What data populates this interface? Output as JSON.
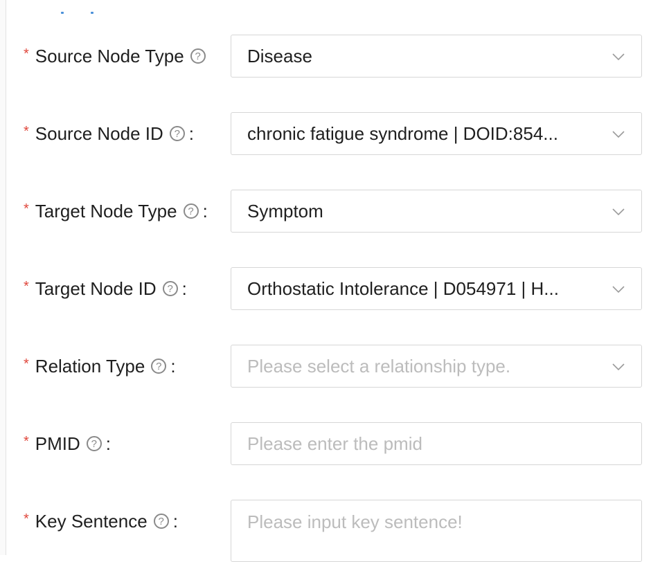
{
  "form": {
    "fields": [
      {
        "label": "Source Node Type",
        "colon": "",
        "value": "Disease",
        "placeholder": "",
        "control": "select"
      },
      {
        "label": "Source Node ID",
        "colon": ":",
        "value": "chronic fatigue syndrome | DOID:854...",
        "placeholder": "",
        "control": "select"
      },
      {
        "label": "Target Node Type",
        "colon": ":",
        "value": "Symptom",
        "placeholder": "",
        "control": "select"
      },
      {
        "label": "Target Node ID",
        "colon": ":",
        "value": "Orthostatic Intolerance | D054971 | H...",
        "placeholder": "",
        "control": "select"
      },
      {
        "label": "Relation Type",
        "colon": ":",
        "value": "",
        "placeholder": "Please select a relationship type.",
        "control": "select"
      },
      {
        "label": "PMID",
        "colon": ":",
        "value": "",
        "placeholder": "Please enter the pmid",
        "control": "input"
      },
      {
        "label": "Key Sentence",
        "colon": ":",
        "value": "",
        "placeholder": "Please input key sentence!",
        "control": "textarea"
      }
    ],
    "required_marker": "*",
    "help_icon": "question-circle-icon",
    "help_glyph": "?",
    "chevron_icon": "chevron-down-icon"
  },
  "colors": {
    "required": "#e0473c",
    "border": "#d6d6d6",
    "placeholder": "#bcbcbc",
    "text": "#1f1f1f"
  }
}
